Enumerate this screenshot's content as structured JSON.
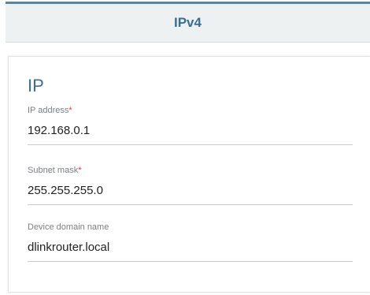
{
  "tab": {
    "title": "IPv4"
  },
  "section": {
    "title": "IP"
  },
  "fields": {
    "ip_address": {
      "label": "IP address",
      "required_mark": "*",
      "value": "192.168.0.1"
    },
    "subnet_mask": {
      "label": "Subnet mask",
      "required_mark": "*",
      "value": "255.255.255.0"
    },
    "domain_name": {
      "label": "Device domain name",
      "value": "dlinkrouter.local"
    }
  },
  "colors": {
    "accent": "#3a6f94",
    "required": "#e0342c"
  }
}
